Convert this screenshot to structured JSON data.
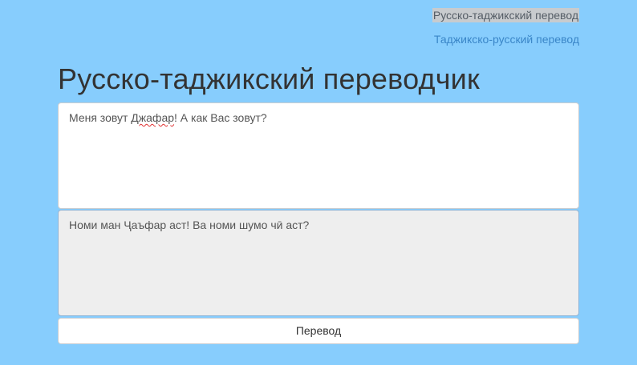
{
  "nav": {
    "items": [
      {
        "label": "Русско-таджикский перевод",
        "active": true
      },
      {
        "label": "Таджикско-русский перевод",
        "active": false
      }
    ]
  },
  "page": {
    "title": "Русско-таджикский переводчик"
  },
  "source": {
    "text_before": "Меня зовут ",
    "misspelled_word": "Джафар",
    "text_after": "! А как Вас зовут?"
  },
  "result": {
    "text": "Номи ман Ҷаъфар аст! Ва номи шумо чӣ аст?"
  },
  "actions": {
    "translate_label": "Перевод"
  },
  "colors": {
    "background": "#87cdfd",
    "link": "#3a86c8"
  }
}
